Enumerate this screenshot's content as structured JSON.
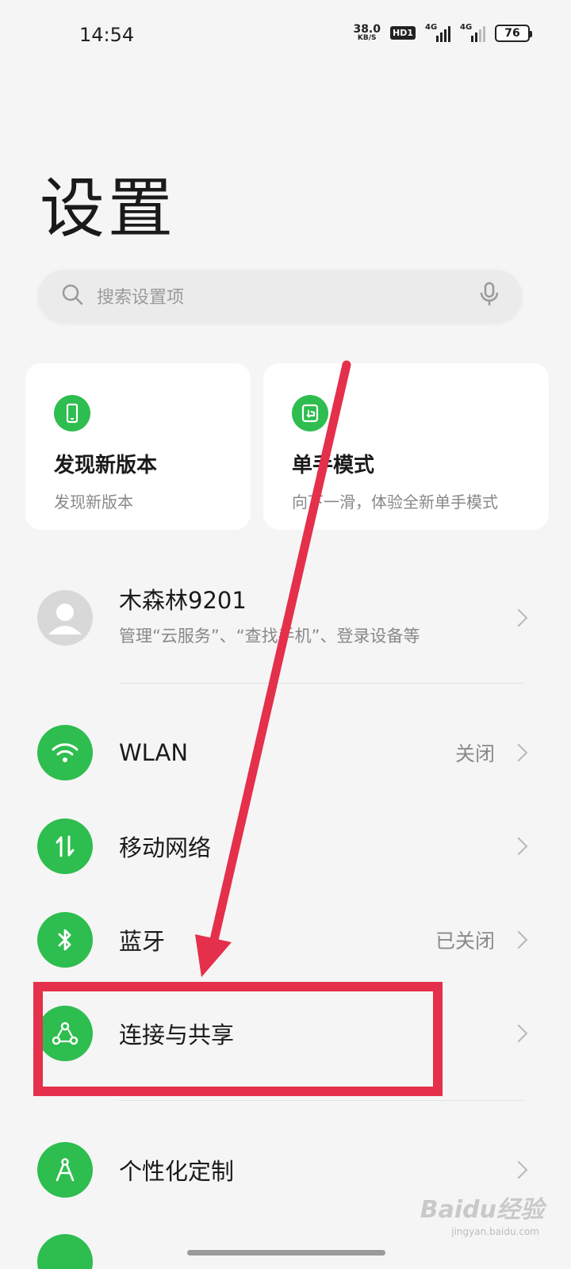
{
  "status_bar": {
    "time": "14:54",
    "net_speed_value": "38.0",
    "net_speed_unit": "KB/S",
    "hd_badge": "HD1",
    "signal1_label": "4G",
    "signal2_label": "4G",
    "battery": "76"
  },
  "page": {
    "title": "设置"
  },
  "search": {
    "placeholder": "搜索设置项"
  },
  "cards": [
    {
      "title": "发现新版本",
      "subtitle": "发现新版本",
      "icon": "phone-icon"
    },
    {
      "title": "单手模式",
      "subtitle": "向下一滑，体验全新单手模式",
      "icon": "one-hand-icon"
    }
  ],
  "account": {
    "name": "木森林9201",
    "subtitle": "管理“云服务”、“查找手机”、登录设备等"
  },
  "settings_items": [
    {
      "label": "WLAN",
      "value": "关闭",
      "icon": "wifi-icon"
    },
    {
      "label": "移动网络",
      "value": "",
      "icon": "mobile-data-icon"
    },
    {
      "label": "蓝牙",
      "value": "已关闭",
      "icon": "bluetooth-icon"
    },
    {
      "label": "连接与共享",
      "value": "",
      "icon": "connection-share-icon"
    },
    {
      "label": "个性化定制",
      "value": "",
      "icon": "personalization-icon"
    }
  ],
  "watermark": {
    "text": "Baidu经验",
    "sub": "jingyan.baidu.com"
  },
  "colors": {
    "accent_green": "#2ebd4f",
    "annotation_red": "#e4304a",
    "background": "#f5f5f5"
  }
}
